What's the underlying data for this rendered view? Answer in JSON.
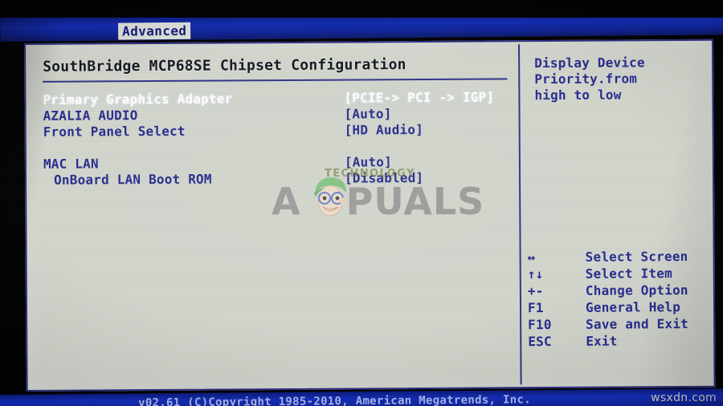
{
  "menubar": {
    "tabs": [
      {
        "label": "Advanced",
        "selected": true
      }
    ]
  },
  "main": {
    "section_title": "SouthBridge MCP68SE Chipset Configuration",
    "rows": [
      {
        "label": "Primary Graphics Adapter",
        "value": "[PCIE-> PCI  -> IGP]",
        "selected": true,
        "indent": false
      },
      {
        "label": "AZALIA AUDIO",
        "value": "[Auto]",
        "selected": false,
        "indent": false
      },
      {
        "label": "Front Panel Select",
        "value": "[HD Audio]",
        "selected": false,
        "indent": false
      },
      {
        "label": "",
        "value": "",
        "selected": false,
        "indent": false,
        "spacer": true
      },
      {
        "label": "MAC LAN",
        "value": "[Auto]",
        "selected": false,
        "indent": false
      },
      {
        "label": "OnBoard LAN Boot ROM",
        "value": "[Disabled]",
        "selected": false,
        "indent": true
      }
    ]
  },
  "help": {
    "lines": [
      "Display Device",
      "Priority.from",
      "high to low"
    ]
  },
  "key_legend": [
    {
      "key": "↔",
      "key_name": "left-right-arrow-icon",
      "desc": "Select Screen"
    },
    {
      "key": "↑↓",
      "key_name": "up-down-arrow-icon",
      "desc": "Select Item"
    },
    {
      "key": "+-",
      "key_name": "plus-minus-icon",
      "desc": "Change Option"
    },
    {
      "key": "F1",
      "key_name": "f1-key",
      "desc": "General Help"
    },
    {
      "key": "F10",
      "key_name": "f10-key",
      "desc": "Save and Exit"
    },
    {
      "key": "ESC",
      "key_name": "esc-key",
      "desc": "Exit"
    }
  ],
  "footer": {
    "copyright": "v02.61 (C)Copyright 1985-2010, American Megatrends, Inc."
  },
  "watermarks": {
    "appuals": "PUALS",
    "appuals_letter": "A",
    "appuals_tagline": "TECHNOLOGY",
    "wsxdn": "wsxdn.com"
  },
  "colors": {
    "panel_bg": "#d2d6cd",
    "text_blue": "#262a8e",
    "selected_text": "#ffffff",
    "border_blue": "#2b2f86",
    "header_blue": "#112bb3",
    "title_dark": "#14161f"
  }
}
